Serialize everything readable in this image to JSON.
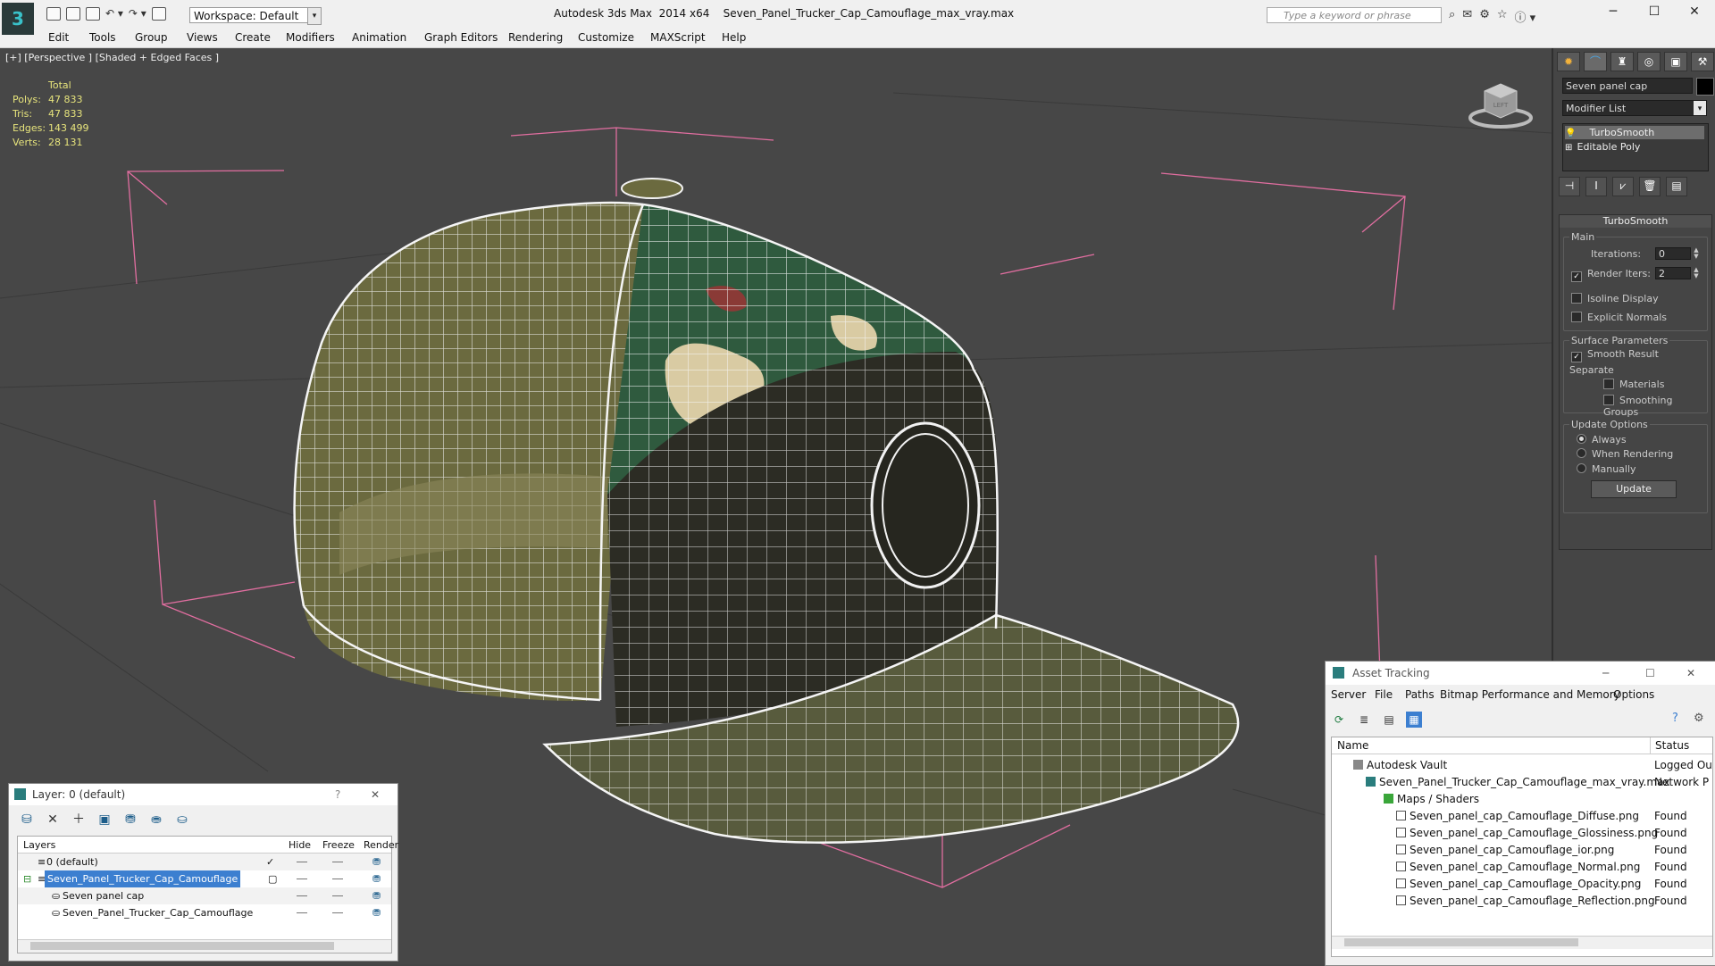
{
  "window": {
    "app_name": "Autodesk 3ds Max  2014 x64",
    "file_name": "Seven_Panel_Trucker_Cap_Camouflage_max_vray.max",
    "workspace": "Workspace: Default",
    "search_placeholder": "Type a keyword or phrase"
  },
  "menu": [
    "Edit",
    "Tools",
    "Group",
    "Views",
    "Create",
    "Modifiers",
    "Animation",
    "Graph Editors",
    "Rendering",
    "Customize",
    "MAXScript",
    "Help"
  ],
  "viewport": {
    "label": "[+] [Perspective ] [Shaded + Edged Faces ]",
    "stats": {
      "header": "Total",
      "polys_label": "Polys:",
      "polys": "47 833",
      "tris_label": "Tris:",
      "tris": "47 833",
      "edges_label": "Edges:",
      "edges": "143 499",
      "verts_label": "Verts:",
      "verts": "28 131"
    },
    "viewcube_label": "LEFT"
  },
  "command_panel": {
    "object_name": "Seven panel cap",
    "modifier_list": "Modifier List",
    "stack": [
      "TurboSmooth",
      "Editable Poly"
    ],
    "rollout_title": "TurboSmooth",
    "main_group": "Main",
    "iterations_label": "Iterations:",
    "iterations_value": "0",
    "render_iters_label": "Render Iters:",
    "render_iters_value": "2",
    "isoline_display": "Isoline Display",
    "explicit_normals": "Explicit Normals",
    "surface_params_group": "Surface Parameters",
    "smooth_result": "Smooth Result",
    "separate_label": "Separate",
    "materials": "Materials",
    "smoothing_groups": "Smoothing Groups",
    "update_options_group": "Update Options",
    "always": "Always",
    "when_rendering": "When Rendering",
    "manually": "Manually",
    "update_button": "Update"
  },
  "layer_window": {
    "title": "Layer: 0 (default)",
    "help": "?",
    "columns": {
      "layers": "Layers",
      "hide": "Hide",
      "freeze": "Freeze",
      "render": "Render"
    },
    "rows": [
      "0 (default)",
      "Seven_Panel_Trucker_Cap_Camouflage",
      "Seven panel cap",
      "Seven_Panel_Trucker_Cap_Camouflage"
    ]
  },
  "asset_window": {
    "title": "Asset Tracking",
    "menu": [
      "Server",
      "File",
      "Paths",
      "Bitmap Performance and Memory",
      "Options"
    ],
    "columns": {
      "name": "Name",
      "status": "Status"
    },
    "rows": [
      {
        "name": "Autodesk Vault",
        "status": "Logged Ou"
      },
      {
        "name": "Seven_Panel_Trucker_Cap_Camouflage_max_vray.max",
        "status": "Network P"
      },
      {
        "name": "Maps / Shaders",
        "status": ""
      },
      {
        "name": "Seven_panel_cap_Camouflage_Diffuse.png",
        "status": "Found"
      },
      {
        "name": "Seven_panel_cap_Camouflage_Glossiness.png",
        "status": "Found"
      },
      {
        "name": "Seven_panel_cap_Camouflage_ior.png",
        "status": "Found"
      },
      {
        "name": "Seven_panel_cap_Camouflage_Normal.png",
        "status": "Found"
      },
      {
        "name": "Seven_panel_cap_Camouflage_Opacity.png",
        "status": "Found"
      },
      {
        "name": "Seven_panel_cap_Camouflage_Reflection.png",
        "status": "Found"
      }
    ]
  },
  "colors": {
    "stats": "#e7e47c",
    "selection": "#3c7fd0",
    "bbox": "#e16ea0"
  }
}
